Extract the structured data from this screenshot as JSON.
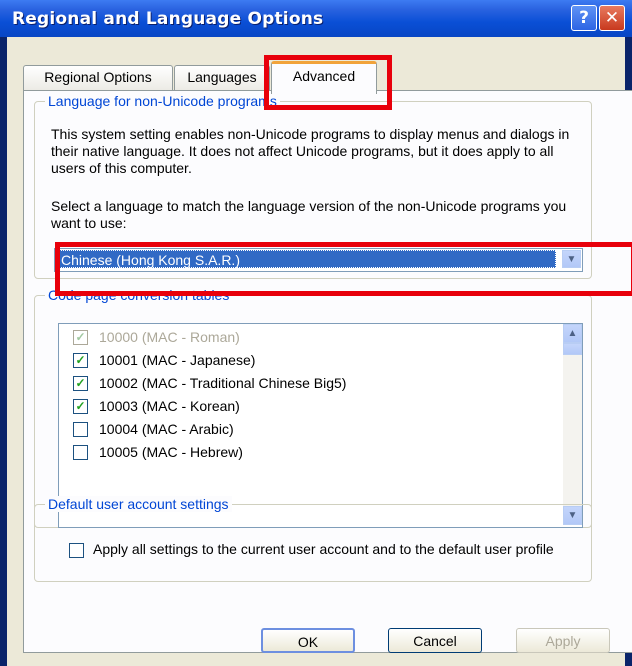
{
  "window": {
    "title": "Regional and Language Options",
    "help_glyph": "?",
    "close_glyph": "✕"
  },
  "tabs": [
    {
      "label": "Regional Options"
    },
    {
      "label": "Languages"
    },
    {
      "label": "Advanced",
      "selected": true
    }
  ],
  "non_unicode": {
    "legend": "Language for non-Unicode programs",
    "description": "This system setting enables non-Unicode programs to display menus and dialogs in their native language. It does not affect Unicode programs, but it does apply to all users of this computer.",
    "select_prompt": "Select a language to match the language version of the non-Unicode programs you want to use:",
    "selected_language": "Chinese (Hong Kong S.A.R.)"
  },
  "code_page": {
    "legend": "Code page conversion tables",
    "items": [
      {
        "label": "10000 (MAC - Roman)",
        "checked": true,
        "disabled": true
      },
      {
        "label": "10001 (MAC - Japanese)",
        "checked": true
      },
      {
        "label": "10002 (MAC - Traditional Chinese Big5)",
        "checked": true
      },
      {
        "label": "10003 (MAC - Korean)",
        "checked": true
      },
      {
        "label": "10004 (MAC - Arabic)",
        "checked": false
      },
      {
        "label": "10005 (MAC - Hebrew)",
        "checked": false
      }
    ]
  },
  "default_user": {
    "legend": "Default user account settings",
    "checkbox_label": "Apply all settings to the current user account and to the default user profile",
    "checked": false
  },
  "buttons": {
    "ok": "OK",
    "cancel": "Cancel",
    "apply": "Apply"
  },
  "icons": {
    "dropdown": "chevron-down-icon",
    "scroll_up": "chevron-up-icon",
    "scroll_down": "chevron-down-icon",
    "check": "checkmark-icon"
  },
  "colors": {
    "title_bar": "#0a4fd6",
    "dialog_bg": "#ece9d8",
    "selection": "#316ac5",
    "highlight_box": "#e8000b",
    "legend_text": "#0046d5"
  }
}
